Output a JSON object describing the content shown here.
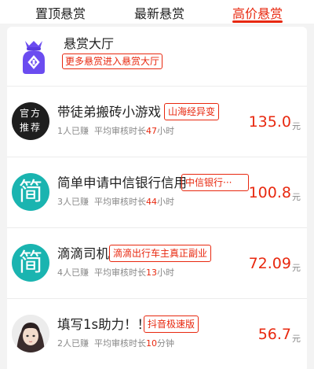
{
  "tabs": [
    {
      "label": "置顶悬赏",
      "active": false
    },
    {
      "label": "最新悬赏",
      "active": false
    },
    {
      "label": "高价悬赏",
      "active": true
    }
  ],
  "colors": {
    "accent": "#e8280f",
    "purple": "#6b4cf0",
    "teal": "#1ab4b0"
  },
  "hall": {
    "title": "悬赏大厅",
    "tag": "更多悬赏进入悬赏大厅",
    "icon": "money-bag-icon"
  },
  "items": [
    {
      "icon_name": "official-recommend-icon",
      "icon_text_1": "官方",
      "icon_text_2": "推荐",
      "title": "带徒弟搬砖小游戏",
      "tag": "山海经异变",
      "earned": "1人已赚",
      "review_prefix": "平均审核时长",
      "review_value": "47",
      "review_unit": "小时",
      "price": "135.0",
      "unit": "元"
    },
    {
      "icon_name": "jian-icon",
      "icon_text": "简",
      "title": "简单申请中信银行信用",
      "tag": "中信银行···",
      "earned": "3人已赚",
      "review_prefix": "平均审核时长",
      "review_value": "44",
      "review_unit": "小时",
      "price": "100.8",
      "unit": "元"
    },
    {
      "icon_name": "jian-icon",
      "icon_text": "简",
      "title": "滴滴司机",
      "tag": "滴滴出行车主真正副业",
      "earned": "4人已赚",
      "review_prefix": "平均审核时长",
      "review_value": "13",
      "review_unit": "小时",
      "price": "72.09",
      "unit": "元"
    },
    {
      "icon_name": "user-avatar-icon",
      "title": "填写1s助力！！",
      "tag": "抖音极速版",
      "earned": "2人已赚",
      "review_prefix": "平均审核时长",
      "review_value": "10",
      "review_unit": "分钟",
      "price": "56.7",
      "unit": "元"
    }
  ]
}
